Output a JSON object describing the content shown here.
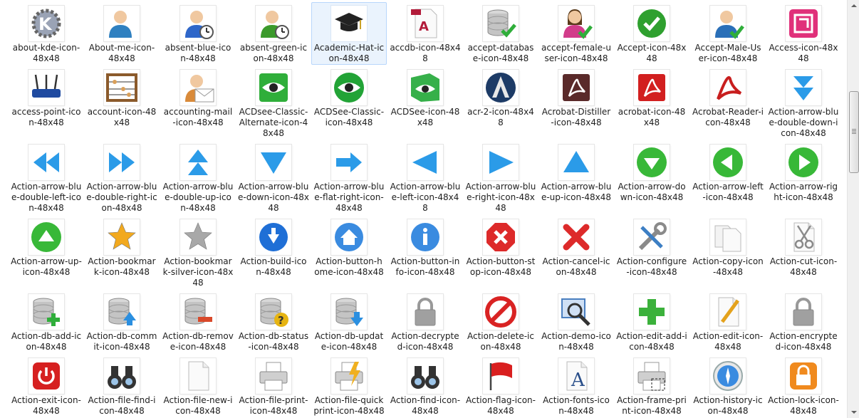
{
  "window": {
    "title": ""
  },
  "items": [
    {
      "label": "about-kde-icon-48x48",
      "icon": "kde-gear-icon",
      "color": "#9aa3b5"
    },
    {
      "label": "About-me-icon-48x48",
      "icon": "user-icon",
      "color": "#2f80c0"
    },
    {
      "label": "absent-blue-icon-48x48",
      "icon": "user-clock-icon",
      "color": "#2e66c9"
    },
    {
      "label": "absent-green-icon-48x48",
      "icon": "user-clock-icon",
      "color": "#3b9a2b"
    },
    {
      "label": "Academic-Hat-icon-48x48",
      "icon": "graduation-cap-icon",
      "color": "#222222",
      "selected": true
    },
    {
      "label": "accdb-icon-48x48",
      "icon": "access-file-icon",
      "color": "#b21b3a"
    },
    {
      "label": "accept-database-icon-48x48",
      "icon": "database-check-icon",
      "color": "#8f8f8f"
    },
    {
      "label": "accept-female-user-icon-48x48",
      "icon": "female-user-check-icon",
      "color": "#d23c8a"
    },
    {
      "label": "Accept-icon-48x48",
      "icon": "check-circle-icon",
      "color": "#2fa02f"
    },
    {
      "label": "Accept-Male-User-icon-48x48",
      "icon": "male-user-check-icon",
      "color": "#2a6fb8"
    },
    {
      "label": "Access-icon-48x48",
      "icon": "access-icon",
      "color": "#e0307a"
    },
    {
      "label": "access-point-icon-48x48",
      "icon": "router-icon",
      "color": "#1f4aa0"
    },
    {
      "label": "account-icon-48x48",
      "icon": "abacus-icon",
      "color": "#8b5a2b"
    },
    {
      "label": "accounting-mail-icon-48x48",
      "icon": "user-mail-icon",
      "color": "#d98a3a"
    },
    {
      "label": "ACDsee-Classic-Alternate-icon-48x48",
      "icon": "eye-square-icon",
      "color": "#2fae3a"
    },
    {
      "label": "ACDSee-Classic-icon-48x48",
      "icon": "eye-circle-icon",
      "color": "#22a336"
    },
    {
      "label": "ACDSee-icon-48x48",
      "icon": "eye-cube-icon",
      "color": "#36b04a"
    },
    {
      "label": "acr-2-icon-48x48",
      "icon": "assassins-emblem-icon",
      "color": "#1d3b66"
    },
    {
      "label": "Acrobat-Distiller-icon-48x48",
      "icon": "acrobat-square-icon",
      "color": "#5a2a2a"
    },
    {
      "label": "acrobat-icon-48x48",
      "icon": "acrobat-square-icon",
      "color": "#d21f1f"
    },
    {
      "label": "Acrobat-Reader-icon-48x48",
      "icon": "acrobat-swirl-icon",
      "color": "#c81e1e"
    },
    {
      "label": "Action-arrow-blue-double-down-icon-48x48",
      "icon": "arrow-double-down-icon",
      "color": "#2b9be8"
    },
    {
      "label": "Action-arrow-blue-double-left-icon-48x48",
      "icon": "arrow-double-left-icon",
      "color": "#2b9be8"
    },
    {
      "label": "Action-arrow-blue-double-right-icon-48x48",
      "icon": "arrow-double-right-icon",
      "color": "#2b9be8"
    },
    {
      "label": "Action-arrow-blue-double-up-icon-48x48",
      "icon": "arrow-double-up-icon",
      "color": "#2b9be8"
    },
    {
      "label": "Action-arrow-blue-down-icon-48x48",
      "icon": "arrow-down-icon",
      "color": "#2b9be8"
    },
    {
      "label": "Action-arrow-blue-flat-right-icon-48x48",
      "icon": "arrow-flat-right-icon",
      "color": "#2b9be8"
    },
    {
      "label": "Action-arrow-blue-left-icon-48x48",
      "icon": "arrow-left-icon",
      "color": "#2b9be8"
    },
    {
      "label": "Action-arrow-blue-right-icon-48x48",
      "icon": "arrow-right-icon",
      "color": "#2b9be8"
    },
    {
      "label": "Action-arrow-blue-up-icon-48x48",
      "icon": "arrow-up-icon",
      "color": "#2b9be8"
    },
    {
      "label": "Action-arrow-down-icon-48x48",
      "icon": "circle-arrow-down-icon",
      "color": "#38b838"
    },
    {
      "label": "Action-arrow-left-icon-48x48",
      "icon": "circle-arrow-left-icon",
      "color": "#38b838"
    },
    {
      "label": "Action-arrow-right-icon-48x48",
      "icon": "circle-arrow-right-icon",
      "color": "#38b838"
    },
    {
      "label": "Action-arrow-up-icon-48x48",
      "icon": "circle-arrow-up-icon",
      "color": "#38b838"
    },
    {
      "label": "Action-bookmark-icon-48x48",
      "icon": "star-icon",
      "color": "#f2a91e"
    },
    {
      "label": "Action-bookmark-silver-icon-48x48",
      "icon": "star-icon",
      "color": "#a8a8a8"
    },
    {
      "label": "Action-build-icon-48x48",
      "icon": "circle-download-icon",
      "color": "#1f6fd6"
    },
    {
      "label": "Action-button-home-icon-48x48",
      "icon": "circle-home-icon",
      "color": "#3a8be0"
    },
    {
      "label": "Action-button-info-icon-48x48",
      "icon": "circle-info-icon",
      "color": "#3a8be0"
    },
    {
      "label": "Action-button-stop-icon-48x48",
      "icon": "octagon-stop-icon",
      "color": "#dd2a2a"
    },
    {
      "label": "Action-cancel-icon-48x48",
      "icon": "red-x-icon",
      "color": "#dd2a2a"
    },
    {
      "label": "Action-configure-icon-48x48",
      "icon": "wrench-screwdriver-icon",
      "color": "#3d7fc4"
    },
    {
      "label": "Action-copy-icon-48x48",
      "icon": "copy-pages-icon",
      "color": "#bfbfbf"
    },
    {
      "label": "Action-cut-icon-48x48",
      "icon": "scissors-page-icon",
      "color": "#8a8a8a"
    },
    {
      "label": "Action-db-add-icon-48x48",
      "icon": "database-add-icon",
      "color": "#2fae3a"
    },
    {
      "label": "Action-db-commit-icon-48x48",
      "icon": "database-up-icon",
      "color": "#2b8fe0"
    },
    {
      "label": "Action-db-remove-icon-48x48",
      "icon": "database-remove-icon",
      "color": "#d9492a"
    },
    {
      "label": "Action-db-status-icon-48x48",
      "icon": "database-question-icon",
      "color": "#e6b412"
    },
    {
      "label": "Action-db-update-icon-48x48",
      "icon": "database-down-icon",
      "color": "#2b8fe0"
    },
    {
      "label": "Action-decrypted-icon-48x48",
      "icon": "padlock-open-icon",
      "color": "#a0a0a0"
    },
    {
      "label": "Action-delete-icon-48x48",
      "icon": "no-entry-icon",
      "color": "#d92323"
    },
    {
      "label": "Action-demo-icon-48x48",
      "icon": "magnifier-screen-icon",
      "color": "#4a7fc0"
    },
    {
      "label": "Action-edit-add-icon-48x48",
      "icon": "plus-icon",
      "color": "#3bb13b"
    },
    {
      "label": "Action-edit-icon-48x48",
      "icon": "pencil-page-icon",
      "color": "#e4a21c"
    },
    {
      "label": "Action-encrypted-icon-48x48",
      "icon": "padlock-closed-icon",
      "color": "#a0a0a0"
    },
    {
      "label": "Action-exit-icon-48x48",
      "icon": "power-button-icon",
      "color": "#d62020"
    },
    {
      "label": "Action-file-find-icon-48x48",
      "icon": "binoculars-icon",
      "color": "#333333"
    },
    {
      "label": "Action-file-new-icon-48x48",
      "icon": "blank-page-icon",
      "color": "#d0d0d0"
    },
    {
      "label": "Action-file-print-icon-48x48",
      "icon": "printer-icon",
      "color": "#3a7cc9"
    },
    {
      "label": "Action-file-quickprint-icon-48x48",
      "icon": "printer-lightning-icon",
      "color": "#f0b020"
    },
    {
      "label": "Action-find-icon-48x48",
      "icon": "binoculars-icon",
      "color": "#333333"
    },
    {
      "label": "Action-flag-icon-48x48",
      "icon": "red-flag-icon",
      "color": "#d91f1f"
    },
    {
      "label": "Action-fonts-icon-48x48",
      "icon": "font-page-icon",
      "color": "#2a4f8a"
    },
    {
      "label": "Action-frame-print-icon-48x48",
      "icon": "printer-frame-icon",
      "color": "#555555"
    },
    {
      "label": "Action-history-icon-48x48",
      "icon": "compass-clock-icon",
      "color": "#3a8be0"
    },
    {
      "label": "Action-lock-icon-48x48",
      "icon": "orange-lock-icon",
      "color": "#f08a1e"
    }
  ]
}
